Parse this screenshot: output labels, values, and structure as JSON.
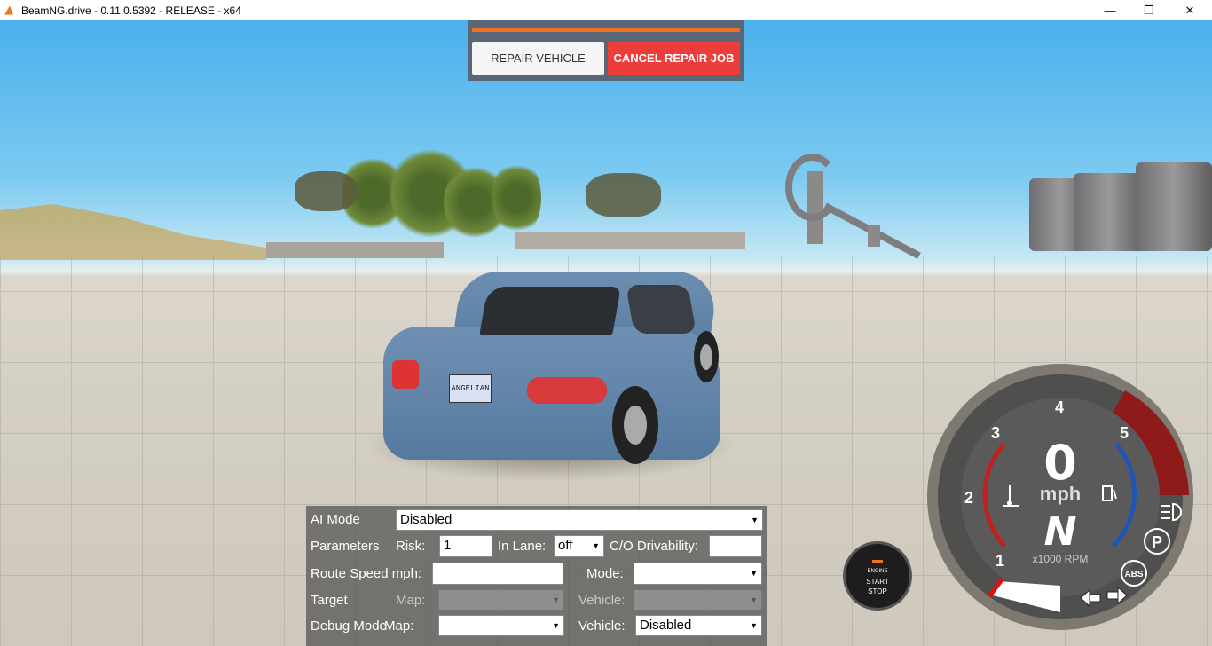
{
  "window": {
    "title": "BeamNG.drive - 0.11.0.5392 - RELEASE - x64",
    "minimize_glyph": "—",
    "maximize_glyph": "❐",
    "close_glyph": "✕"
  },
  "repair": {
    "repair_label": "REPAIR VEHICLE",
    "cancel_label": "CANCEL REPAIR JOB",
    "progress_color": "#f36f22",
    "cancel_color": "#ec3d3b"
  },
  "car": {
    "plate": "ANGELIAN"
  },
  "ai_panel": {
    "ai_mode_label": "AI Mode",
    "ai_mode_value": "Disabled",
    "parameters_label": "Parameters",
    "risk_label": "Risk:",
    "risk_value": "1",
    "in_lane_label": "In Lane:",
    "in_lane_value": "off",
    "co_drivability_label": "C/O Drivability:",
    "co_drivability_value": "",
    "route_speed_label": "Route Speed mph:",
    "route_speed_value": "",
    "mode_label": "Mode:",
    "mode_value": "",
    "target_label": "Target",
    "target_map_label": "Map:",
    "target_map_value": "",
    "target_vehicle_label": "Vehicle:",
    "target_vehicle_value": "",
    "debug_label": "Debug Mode",
    "debug_map_label": "Map:",
    "debug_map_value": "",
    "debug_vehicle_label": "Vehicle:",
    "debug_vehicle_value": "Disabled"
  },
  "engine_button": {
    "line1": "ENGINE",
    "line2": "START",
    "line3": "STOP"
  },
  "gauge": {
    "speed": "0",
    "unit": "mph",
    "gear": "N",
    "rpm_label": "x1000 RPM",
    "ticks": [
      "1",
      "2",
      "3",
      "4",
      "5"
    ],
    "park_label": "P",
    "abs_label": "ABS",
    "redline_color": "#8e1a1a",
    "rpm_arc_color": "#1f56b3",
    "temp_arc_color": "#c21f1f"
  }
}
